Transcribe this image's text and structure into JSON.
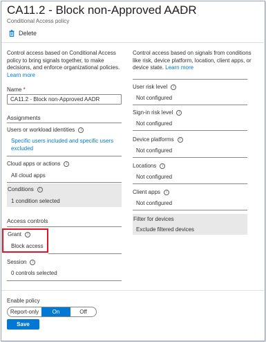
{
  "header": {
    "title": "CA11.2 - Block non-Approved AADR",
    "more_actions": "···",
    "subtitle": "Conditional Access policy"
  },
  "toolbar": {
    "delete_label": "Delete"
  },
  "left": {
    "description": [
      "Control access based on Conditional Access",
      "policy to bring signals together, to make",
      "decisions, and enforce organizational policies."
    ],
    "learn_more": "Learn more",
    "name_label": "Name",
    "name_required": "*",
    "name_value": "CA11.2 - Block non-Approved AADR",
    "assignments_title": "Assignments",
    "users_label": "Users or workload identities",
    "users_value": [
      "Specific users included and specific users",
      "excluded"
    ],
    "cloud_label": "Cloud apps or actions",
    "cloud_value": "All cloud apps",
    "conditions_label": "Conditions",
    "conditions_value": "1 condition selected",
    "access_title": "Access controls",
    "grant_label": "Grant",
    "grant_value": "Block access",
    "session_label": "Session",
    "session_value": "0 controls selected"
  },
  "right": {
    "description": [
      "Control access based on signals from conditions",
      "like risk, device platform, location, client apps, or"
    ],
    "description_end": "device state.",
    "learn_more": "Learn more",
    "user_risk_label": "User risk level",
    "user_risk_value": "Not configured",
    "signin_risk_label": "Sign-in risk level",
    "signin_risk_value": "Not configured",
    "device_platforms_label": "Device platforms",
    "device_platforms_value": "Not configured",
    "locations_label": "Locations",
    "locations_value": "Not configured",
    "client_apps_label": "Client apps",
    "client_apps_value": "Not configured",
    "filter_label": "Filter for devices",
    "filter_value": "Exclude filtered devices"
  },
  "footer": {
    "enable_label": "Enable policy",
    "toggle_options": [
      "Report-only",
      "On",
      "Off"
    ],
    "toggle_selected": "On",
    "save_label": "Save"
  },
  "colors": {
    "accent": "#0078d4",
    "highlight_border": "#e81123",
    "shaded_row": "#e8e8e8"
  },
  "icons": {
    "delete": "trash-icon",
    "info": "info-icon"
  }
}
